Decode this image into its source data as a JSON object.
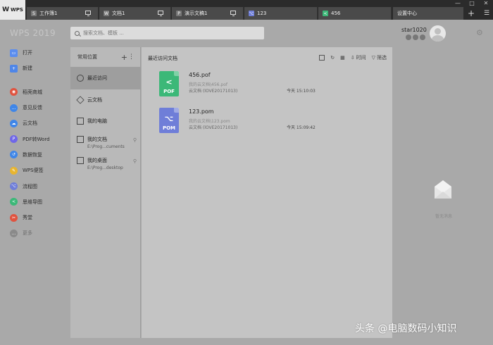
{
  "titlebar": {
    "logo": "WPS",
    "tabs": [
      {
        "label": "工作簿1",
        "icon": "spreadsheet-icon",
        "color": "#777777"
      },
      {
        "label": "文档1",
        "icon": "document-icon",
        "color": "#777777"
      },
      {
        "label": "演示文稿1",
        "icon": "presentation-icon",
        "color": "#777777"
      },
      {
        "label": "123",
        "icon": "pom-icon",
        "color": "#6f7ed8"
      },
      {
        "label": "456",
        "icon": "pof-icon",
        "color": "#3cb878"
      }
    ],
    "settings_tab": "设置中心",
    "add_tab": "+",
    "window_controls": [
      "—",
      "□",
      "✕"
    ]
  },
  "header": {
    "brand": "WPS 2019",
    "search_placeholder": "搜索文档、模板 ...",
    "username": "star1020"
  },
  "sidebar": {
    "items": [
      {
        "label": "打开",
        "icon": "folder-open-icon",
        "color": "#5b8def"
      },
      {
        "label": "新建",
        "icon": "plus-square-icon",
        "color": "#4f86e8"
      },
      {
        "label": "稻壳商城",
        "icon": "store-icon",
        "color": "#e0533f"
      },
      {
        "label": "意见反馈",
        "icon": "feedback-icon",
        "color": "#3f86e8"
      },
      {
        "label": "云文档",
        "icon": "cloud-doc-icon",
        "color": "#3f86e8"
      },
      {
        "label": "PDF转Word",
        "icon": "pdf-convert-icon",
        "color": "#6f67e8"
      },
      {
        "label": "数据恢复",
        "icon": "data-recovery-icon",
        "color": "#3f86e8"
      },
      {
        "label": "WPS便签",
        "icon": "note-icon",
        "color": "#e8b52f"
      },
      {
        "label": "流程图",
        "icon": "flowchart-icon",
        "color": "#6f7ed8"
      },
      {
        "label": "思维导图",
        "icon": "mindmap-icon",
        "color": "#3cb878"
      },
      {
        "label": "秀堂",
        "icon": "showroom-icon",
        "color": "#e0533f"
      },
      {
        "label": "更多",
        "icon": "more-icon",
        "color": "#8a8a8a"
      }
    ]
  },
  "locations": {
    "header": "常用位置",
    "items": [
      {
        "label": "最近访问",
        "icon": "clock-icon"
      },
      {
        "label": "云文档",
        "icon": "cube-icon"
      },
      {
        "label": "我的电脑",
        "icon": "computer-icon"
      },
      {
        "label": "我的文档",
        "sub": "E:\\Prog...cuments",
        "icon": "documents-icon"
      },
      {
        "label": "我的桌面",
        "sub": "E:\\Prog...desktop",
        "icon": "desktop-icon"
      }
    ]
  },
  "main": {
    "title": "最近访问文档",
    "toolbar": {
      "sort": "时间",
      "filter": "筛选"
    },
    "files": [
      {
        "name": "456.pof",
        "badge": "POF",
        "path": "我的云文档\\456.pof",
        "location": "云文档 (lOVE20171013)",
        "time": "今天 15:10:03",
        "color": "#3cb878",
        "icon": "pof-file-icon"
      },
      {
        "name": "123.pom",
        "badge": "POM",
        "path": "我的云文档\\123.pom",
        "location": "云文档 (lOVE20171013)",
        "time": "今天 15:09:42",
        "color": "#6f7ed8",
        "icon": "pom-file-icon"
      }
    ]
  },
  "right_panel": {
    "empty_text": "暂无消息"
  },
  "watermark": "头条 @电脑数码小知识"
}
